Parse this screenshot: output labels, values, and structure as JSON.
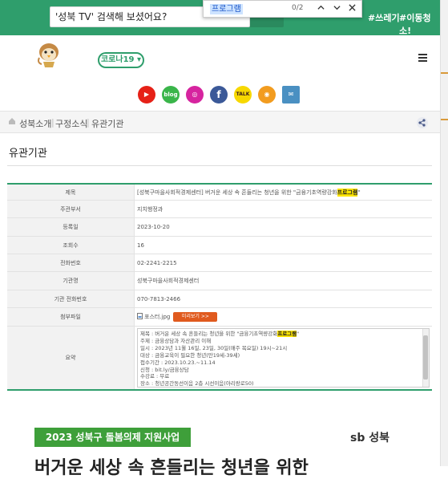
{
  "search": {
    "value": "'성북 TV' 검색해 보셨어요?"
  },
  "find_bar": {
    "query": "프로그램",
    "count": "0/2",
    "up_icon": "chevron-up",
    "down_icon": "chevron-down",
    "close_icon": "close"
  },
  "hashtags": [
    "#쓰레기",
    "#이동청소!"
  ],
  "covid_button": "코로나19 ▾",
  "social": [
    {
      "name": "youtube-icon",
      "color": "#e62117",
      "glyph": "▶"
    },
    {
      "name": "blog-icon",
      "color": "#3ab54a",
      "glyph": "blog"
    },
    {
      "name": "instagram-icon",
      "color": "#d6249f",
      "glyph": "◎"
    },
    {
      "name": "facebook-icon",
      "color": "#3b5998",
      "glyph": "f"
    },
    {
      "name": "kakaotalk-icon",
      "color": "#f7d800",
      "glyph": "TALK"
    },
    {
      "name": "kakaostory-icon",
      "color": "#f29c1f",
      "glyph": "◉"
    },
    {
      "name": "newsletter-icon",
      "color": "#4a90c2",
      "glyph": "✉"
    }
  ],
  "breadcrumb": [
    "성북소개",
    "구정소식",
    "유관기관"
  ],
  "page_title": "유관기관",
  "table": {
    "labels": {
      "subject": "제목",
      "dept": "주관부서",
      "date": "등록일",
      "views": "조회수",
      "phone": "전화번호",
      "org": "기관명",
      "org_phone": "기관 전화번호",
      "attach": "첨부파일",
      "summary": "요약"
    },
    "subject_pre": "[성북구마을사회적경제센터] 버거운 세상 속 흔들리는 청년을 위한 \"금융기초역량강화",
    "subject_hl": "프로그램",
    "subject_post": "\"",
    "dept": "지치행정과",
    "date": "2023-10-20",
    "views": "16",
    "phone": "02-2241-2215",
    "org": "성북구마을사회적경제센터",
    "org_phone": "070-7813-2466",
    "attach_file": "포스터.jpg",
    "preview_label": "미리보기",
    "summary_lines": [
      "주제 : 금융상담과 자산관리 이해",
      "일시 : 2023년 11월 16일, 23일, 30일(매주 목요일) 19시~21시",
      "대상 : 금융교육이 필요한 청년(만19세-39세)",
      "접수기간 : 2023.10.23.~11.14",
      "신청 : bit.ly/금융상담",
      "수강료 : 무료",
      "장소 : 청년공간동선이음 2층 시선이음(아리랑로50)"
    ],
    "summary_first_pre": "제목 : 버거운 세상 속 흔들리는 청년을 위한 \"금융기초역량강화",
    "summary_first_hl": "프로그램",
    "summary_first_post": "\""
  },
  "banner": "2023 성북구 돌봄의제 지원사업",
  "sb_logo": "sb 성북",
  "headline_cut": "버거운 세상 속 흔들리는 청년을 위한"
}
